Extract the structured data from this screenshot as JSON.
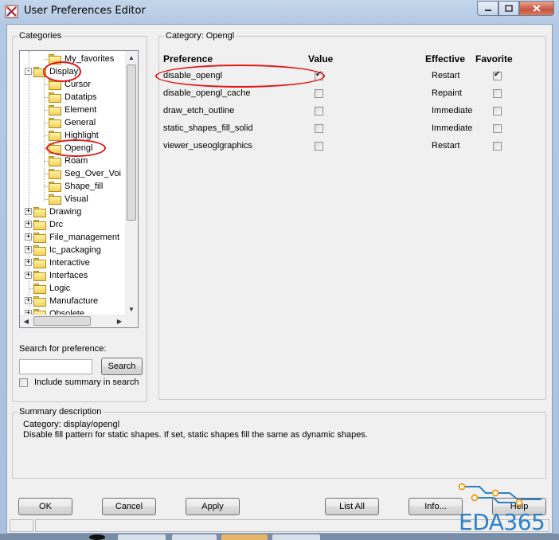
{
  "window": {
    "title": "User Preferences Editor"
  },
  "categories": {
    "legend": "Categories",
    "tree": [
      {
        "label": "My_favorites",
        "level": 1,
        "expander": ""
      },
      {
        "label": "Display",
        "level": 0,
        "expander": "-"
      },
      {
        "label": "Cursor",
        "level": 1,
        "expander": ""
      },
      {
        "label": "Datatips",
        "level": 1,
        "expander": ""
      },
      {
        "label": "Element",
        "level": 1,
        "expander": ""
      },
      {
        "label": "General",
        "level": 1,
        "expander": ""
      },
      {
        "label": "Highlight",
        "level": 1,
        "expander": ""
      },
      {
        "label": "Opengl",
        "level": 1,
        "expander": ""
      },
      {
        "label": "Roam",
        "level": 1,
        "expander": ""
      },
      {
        "label": "Seg_Over_Voi",
        "level": 1,
        "expander": ""
      },
      {
        "label": "Shape_fill",
        "level": 1,
        "expander": ""
      },
      {
        "label": "Visual",
        "level": 1,
        "expander": ""
      },
      {
        "label": "Drawing",
        "level": 0,
        "expander": "+"
      },
      {
        "label": "Drc",
        "level": 0,
        "expander": "+"
      },
      {
        "label": "File_management",
        "level": 0,
        "expander": "+"
      },
      {
        "label": "Ic_packaging",
        "level": 0,
        "expander": "+"
      },
      {
        "label": "Interactive",
        "level": 0,
        "expander": "+"
      },
      {
        "label": "Interfaces",
        "level": 0,
        "expander": "+"
      },
      {
        "label": "Logic",
        "level": 0,
        "expander": ""
      },
      {
        "label": "Manufacture",
        "level": 0,
        "expander": "+"
      },
      {
        "label": "Obsolete",
        "level": 0,
        "expander": "+"
      }
    ],
    "selected": "Opengl",
    "search_label": "Search for preference:",
    "search_value": "",
    "search_button": "Search",
    "include_summary_label": "Include summary in search",
    "include_summary_checked": false
  },
  "category_panel": {
    "legend": "Category:  Opengl",
    "headers": {
      "preference": "Preference",
      "value": "Value",
      "effective": "Effective",
      "favorite": "Favorite"
    },
    "rows": [
      {
        "name": "disable_opengl",
        "value": true,
        "effective": "Restart",
        "favorite": true
      },
      {
        "name": "disable_opengl_cache",
        "value": false,
        "effective": "Repaint",
        "favorite": false
      },
      {
        "name": "draw_etch_outline",
        "value": false,
        "effective": "Immediate",
        "favorite": false
      },
      {
        "name": "static_shapes_fill_solid",
        "value": false,
        "effective": "Immediate",
        "favorite": false
      },
      {
        "name": "viewer_useoglgraphics",
        "value": false,
        "effective": "Restart",
        "favorite": false
      }
    ]
  },
  "summary": {
    "legend": "Summary description",
    "line1": "Category: display/opengl",
    "line2": "Disable fill pattern for static shapes. If set, static shapes fill the same as dynamic shapes."
  },
  "buttons": {
    "ok": "OK",
    "cancel": "Cancel",
    "apply": "Apply",
    "list_all": "List All",
    "info": "Info...",
    "help": "Help"
  },
  "watermark": {
    "text": "EDA365"
  },
  "colors": {
    "annotation": "#e01818",
    "watermark": "#2e80c8",
    "window_frame": "#b3c9e3"
  }
}
